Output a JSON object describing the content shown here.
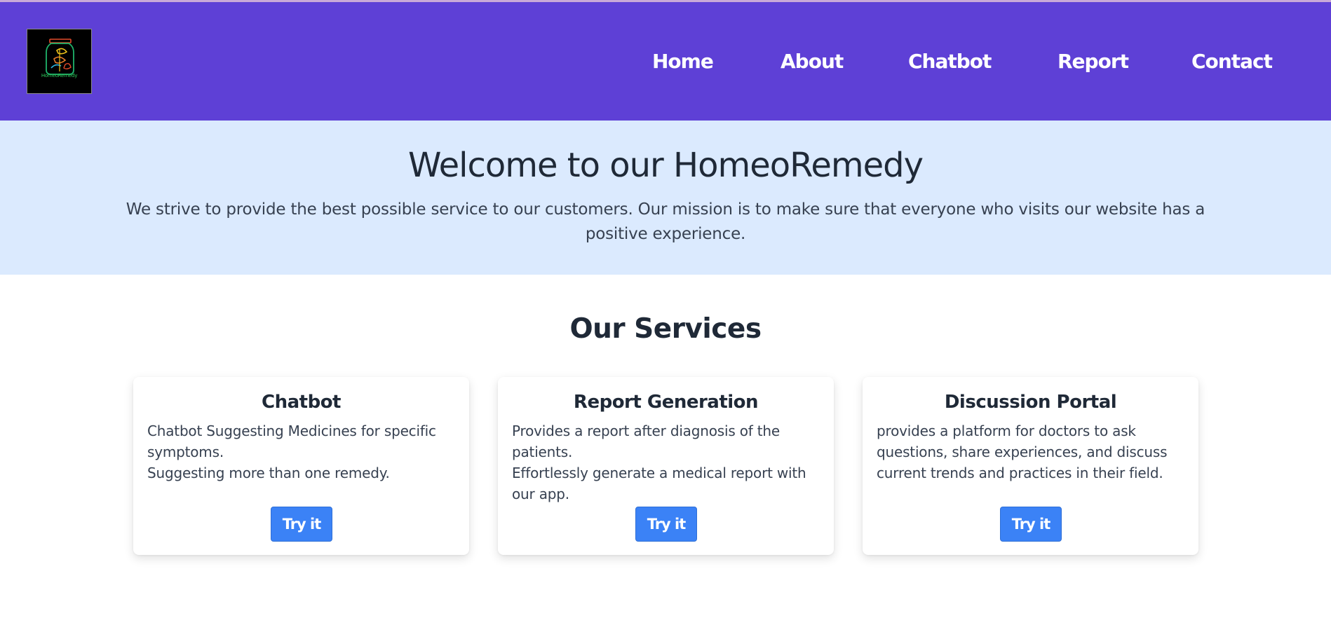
{
  "colors": {
    "navbar": "#5e40d6",
    "hero_background": "#dbeafe",
    "button": "#3b82f6",
    "logo_background": "#000000"
  },
  "logo": {
    "icon": "homeoremedy-logo",
    "text": "HomeoRemedy"
  },
  "nav": {
    "items": [
      {
        "label": "Home"
      },
      {
        "label": "About"
      },
      {
        "label": "Chatbot"
      },
      {
        "label": "Report"
      },
      {
        "label": "Contact"
      }
    ]
  },
  "hero": {
    "title": "Welcome to our HomeoRemedy",
    "text": "We strive to provide the best possible service to our customers. Our mission is to make sure that everyone who visits our website has a positive experience."
  },
  "services": {
    "title": "Our Services",
    "cards": [
      {
        "title": "Chatbot",
        "lines": [
          "Chatbot Suggesting Medicines for specific symptoms.",
          "Suggesting more than one remedy."
        ],
        "button": "Try it"
      },
      {
        "title": "Report Generation",
        "lines": [
          "Provides a report after diagnosis of the patients.",
          "Effortlessly generate a medical report with our app."
        ],
        "button": "Try it"
      },
      {
        "title": "Discussion Portal",
        "lines": [
          "provides a platform for doctors to ask questions, share experiences, and discuss current trends and practices in their field."
        ],
        "button": "Try it"
      }
    ]
  }
}
